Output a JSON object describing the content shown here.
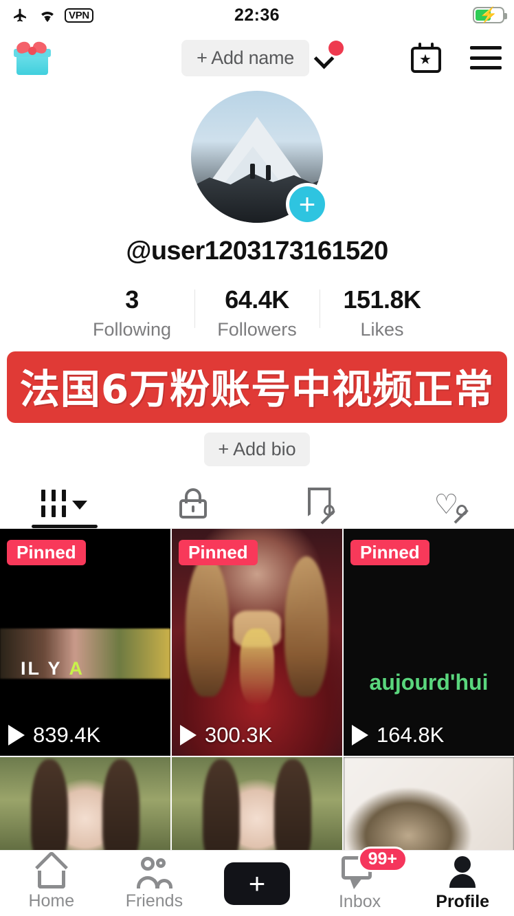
{
  "status_bar": {
    "time": "22:36",
    "icons": [
      "airplane-mode-icon",
      "wifi-icon",
      "vpn-badge",
      "battery-charging-icon"
    ],
    "vpn_label": "VPN",
    "battery_percent": 58,
    "charging": true
  },
  "header": {
    "gift_icon": "gift-box-icon",
    "add_name_label": "+ Add name",
    "chevron_icon": "chevron-down-icon",
    "has_notification_dot": true,
    "calendar_icon": "calendar-star-icon",
    "menu_icon": "hamburger-menu-icon"
  },
  "profile": {
    "avatar_alt": "mountain-summit-photo",
    "avatar_plus_label": "+",
    "username": "@user1203173161520",
    "stats": [
      {
        "value": "3",
        "label": "Following"
      },
      {
        "value": "64.4K",
        "label": "Followers"
      },
      {
        "value": "151.8K",
        "label": "Likes"
      }
    ],
    "banner_text": "法国6万粉账号中视频正常",
    "banner_color": "#e03a36",
    "add_bio_label": "+ Add bio"
  },
  "tabs": [
    {
      "name": "videos-grid",
      "icon": "grid-icon",
      "active": true,
      "has_dropdown": true
    },
    {
      "name": "private",
      "icon": "lock-icon",
      "active": false
    },
    {
      "name": "saved",
      "icon": "bookmark-hidden-icon",
      "active": false
    },
    {
      "name": "liked",
      "icon": "heart-hidden-icon",
      "active": false
    }
  ],
  "videos": [
    {
      "pinned_label": "Pinned",
      "views": "839.4K",
      "caption": "IL Y A",
      "caption_accent": "A",
      "play_icon": "play-icon"
    },
    {
      "pinned_label": "Pinned",
      "views": "300.3K",
      "caption": "",
      "play_icon": "play-icon"
    },
    {
      "pinned_label": "Pinned",
      "views": "164.8K",
      "caption": "aujourd'hui",
      "play_icon": "play-icon"
    },
    {
      "pinned_label": "",
      "views": "",
      "caption": ""
    },
    {
      "pinned_label": "",
      "views": "",
      "caption": ""
    },
    {
      "pinned_label": "",
      "views": "",
      "caption": ""
    }
  ],
  "bottom_nav": [
    {
      "label": "Home",
      "icon": "home-icon",
      "active": false,
      "badge": ""
    },
    {
      "label": "Friends",
      "icon": "friends-icon",
      "active": false,
      "badge": ""
    },
    {
      "label": "",
      "icon": "create-plus-icon",
      "active": false,
      "badge": "",
      "plus": "+"
    },
    {
      "label": "Inbox",
      "icon": "inbox-icon",
      "active": false,
      "badge": "99+"
    },
    {
      "label": "Profile",
      "icon": "profile-icon",
      "active": true,
      "badge": ""
    }
  ]
}
